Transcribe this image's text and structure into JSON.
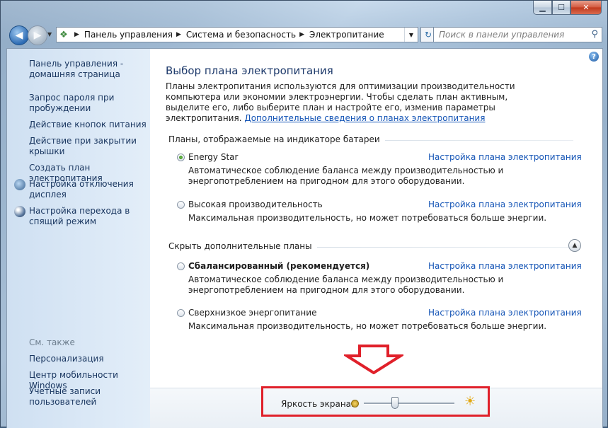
{
  "window": {
    "minimize": "▁",
    "maximize": "☐",
    "close": "✕"
  },
  "nav": {
    "back_icon": "arrow-left-icon",
    "forward_icon": "arrow-right-icon",
    "breadcrumbs": [
      "Панель управления",
      "Система и безопасность",
      "Электропитание"
    ],
    "search_placeholder": "Поиск в панели управления"
  },
  "sidebar": {
    "items": [
      {
        "label": "Панель управления - домашняя страница"
      },
      {
        "label": "Запрос пароля при пробуждении"
      },
      {
        "label": "Действие кнопок питания"
      },
      {
        "label": "Действие при закрытии крышки"
      },
      {
        "label": "Создать план электропитания"
      },
      {
        "label": "Настройка отключения дисплея"
      },
      {
        "label": "Настройка перехода в спящий режим"
      }
    ],
    "see_also_title": "См. также",
    "see_also": [
      {
        "label": "Персонализация"
      },
      {
        "label": "Центр мобильности Windows"
      },
      {
        "label": "Учетные записи пользователей"
      }
    ]
  },
  "main": {
    "title": "Выбор плана электропитания",
    "intro": "Планы электропитания используются для оптимизации производительности компьютера или экономии электроэнергии. Чтобы сделать план активным, выделите его, либо выберите план и настройте его, изменив параметры электропитания.",
    "more_link": "Дополнительные сведения о планах электропитания",
    "group1_title": "Планы, отображаемые на индикаторе батареи",
    "group2_title": "Скрыть дополнительные планы",
    "settings_link": "Настройка плана электропитания",
    "plans": [
      {
        "name": "Energy Star",
        "desc": "Автоматическое соблюдение баланса между производительностью и энергопотреблением на пригодном для этого оборудовании.",
        "selected": true
      },
      {
        "name": "Высокая производительность",
        "desc": "Максимальная производительность, но может потребоваться больше энергии.",
        "selected": false
      },
      {
        "name": "Сбалансированный (рекомендуется)",
        "desc": "Автоматическое соблюдение баланса между производительностью и энергопотреблением на пригодном для этого оборудовании.",
        "selected": false
      },
      {
        "name": "Сверхнизкое энергопитание",
        "desc": "Максимальная производительность, но может потребоваться больше энергии.",
        "selected": false
      }
    ]
  },
  "brightness": {
    "label": "Яркость экрана:",
    "level": 0.33,
    "highlight_color": "#e0202a"
  },
  "colors": {
    "link": "#1555b6",
    "title": "#1e3a6b",
    "sidebar_bg": "#dbe8f6"
  }
}
